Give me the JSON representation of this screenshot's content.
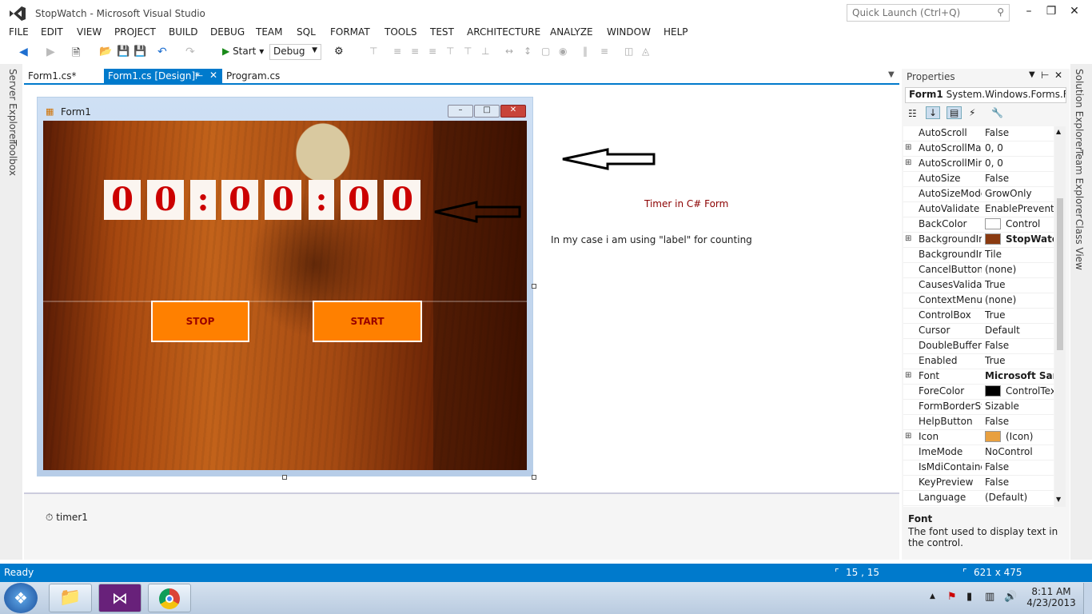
{
  "window": {
    "title": "StopWatch - Microsoft Visual Studio",
    "quick_launch_placeholder": "Quick Launch (Ctrl+Q)",
    "min": "–",
    "max": "❐",
    "close": "✕"
  },
  "menu": [
    "FILE",
    "EDIT",
    "VIEW",
    "PROJECT",
    "BUILD",
    "DEBUG",
    "TEAM",
    "SQL",
    "FORMAT",
    "TOOLS",
    "TEST",
    "ARCHITECTURE",
    "ANALYZE",
    "WINDOW",
    "HELP"
  ],
  "toolbar": {
    "start_label": "Start",
    "config": "Debug"
  },
  "side_tabs_left": [
    "Server Explorer",
    "Toolbox"
  ],
  "side_tabs_right": [
    "Solution Explorer",
    "Team Explorer",
    "Class View"
  ],
  "doc_tabs": [
    "Form1.cs*",
    "Form1.cs [Design]*",
    "Program.cs"
  ],
  "form": {
    "caption": "Form1",
    "digits": [
      "0",
      "0",
      ":",
      "0",
      "0",
      ":",
      "0",
      "0"
    ],
    "stop_label": "STOP",
    "start_label": "START"
  },
  "annotations": {
    "timer_title": "Timer in C# Form",
    "note": "In my case i am using \"label\" for counting"
  },
  "tray": {
    "component": "timer1"
  },
  "properties": {
    "header": "Properties",
    "object": "Form1",
    "object_type": "System.Windows.Forms.Fo",
    "rows": [
      {
        "expand": "",
        "name": "AutoScroll",
        "value": "False"
      },
      {
        "expand": "⊞",
        "name": "AutoScrollMargin",
        "value": "0, 0"
      },
      {
        "expand": "⊞",
        "name": "AutoScrollMinSize",
        "value": "0, 0"
      },
      {
        "expand": "",
        "name": "AutoSize",
        "value": "False"
      },
      {
        "expand": "",
        "name": "AutoSizeMode",
        "value": "GrowOnly"
      },
      {
        "expand": "",
        "name": "AutoValidate",
        "value": "EnablePreventFocusChange"
      },
      {
        "expand": "",
        "name": "BackColor",
        "value": "Control",
        "swatch": "#ffffff"
      },
      {
        "expand": "⊞",
        "name": "BackgroundImage",
        "value": "StopWatch",
        "swatch": "#8a3a10",
        "bold": true
      },
      {
        "expand": "",
        "name": "BackgroundImageLayout",
        "value": "Tile"
      },
      {
        "expand": "",
        "name": "CancelButton",
        "value": "(none)"
      },
      {
        "expand": "",
        "name": "CausesValidation",
        "value": "True"
      },
      {
        "expand": "",
        "name": "ContextMenuStrip",
        "value": "(none)"
      },
      {
        "expand": "",
        "name": "ControlBox",
        "value": "True"
      },
      {
        "expand": "",
        "name": "Cursor",
        "value": "Default"
      },
      {
        "expand": "",
        "name": "DoubleBuffered",
        "value": "False"
      },
      {
        "expand": "",
        "name": "Enabled",
        "value": "True"
      },
      {
        "expand": "⊞",
        "name": "Font",
        "value": "Microsoft Sans",
        "bold": true
      },
      {
        "expand": "",
        "name": "ForeColor",
        "value": "ControlText",
        "swatch": "#000000"
      },
      {
        "expand": "",
        "name": "FormBorderStyle",
        "value": "Sizable"
      },
      {
        "expand": "",
        "name": "HelpButton",
        "value": "False"
      },
      {
        "expand": "⊞",
        "name": "Icon",
        "value": "(Icon)",
        "swatch": "#e8a040"
      },
      {
        "expand": "",
        "name": "ImeMode",
        "value": "NoControl"
      },
      {
        "expand": "",
        "name": "IsMdiContainer",
        "value": "False"
      },
      {
        "expand": "",
        "name": "KeyPreview",
        "value": "False"
      },
      {
        "expand": "",
        "name": "Language",
        "value": "(Default)"
      }
    ],
    "desc_title": "Font",
    "desc_text": "The font used to display text in the control."
  },
  "status": {
    "text": "Ready",
    "position": "15 , 15",
    "size": "621 x 475"
  },
  "taskbar": {
    "time": "8:11 AM",
    "date": "4/23/2013"
  },
  "colors": {
    "accent": "#007acc",
    "button": "#ff8000",
    "digit": "#cc0000"
  }
}
